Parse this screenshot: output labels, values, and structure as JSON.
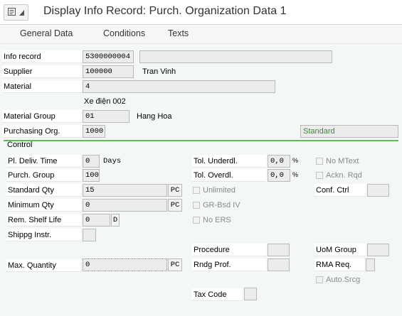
{
  "window": {
    "title": "Display Info Record: Purch. Organization Data 1"
  },
  "tabs": [
    {
      "label": "General Data"
    },
    {
      "label": "Conditions"
    },
    {
      "label": "Texts"
    }
  ],
  "header": {
    "info_record_label": "Info record",
    "info_record_value": "5300000004",
    "supplier_label": "Supplier",
    "supplier_value": "100000",
    "supplier_name": "Tran Vinh",
    "material_label": "Material",
    "material_value": "4",
    "material_desc": "Xe điện 002",
    "material_group_label": "Material Group",
    "material_group_value": "01",
    "material_group_desc": "Hang Hoa",
    "purch_org_label": "Purchasing Org.",
    "purch_org_value": "1000",
    "standard_label": "Standard"
  },
  "control": {
    "title": "Control",
    "pl_deliv_time_label": "Pl. Deliv. Time",
    "pl_deliv_time_value": "0",
    "days_label": "Days",
    "purch_group_label": "Purch. Group",
    "purch_group_value": "100",
    "standard_qty_label": "Standard Qty",
    "standard_qty_value": "15",
    "standard_qty_unit": "PC",
    "minimum_qty_label": "Minimum Qty",
    "minimum_qty_value": "0",
    "minimum_qty_unit": "PC",
    "rem_shelf_life_label": "Rem. Shelf Life",
    "rem_shelf_life_value": "0",
    "rem_shelf_life_unit": "D",
    "shippg_instr_label": "Shippg Instr.",
    "max_quantity_label": "Max. Quantity",
    "max_quantity_value": "0",
    "max_quantity_unit": "PC",
    "tol_underdl_label": "Tol. Underdl.",
    "tol_underdl_value": "0,0",
    "tol_overdl_label": "Tol. Overdl.",
    "tol_overdl_value": "0,0",
    "percent": "%",
    "unlimited_label": "Unlimited",
    "gr_bsd_iv_label": "GR-Bsd IV",
    "no_ers_label": "No ERS",
    "no_mtext_label": "No MText",
    "ackn_rqd_label": "Ackn. Rqd",
    "conf_ctrl_label": "Conf. Ctrl",
    "procedure_label": "Procedure",
    "uom_group_label": "UoM Group",
    "rndg_prof_label": "Rndg Prof.",
    "rma_req_label": "RMA Req.",
    "auto_srcg_label": "Auto.Srcg",
    "tax_code_label": "Tax Code"
  },
  "colors": {
    "accent": "#5bbf55",
    "readonly_bg": "#ececec"
  },
  "icons": {
    "menu": "menu-icon",
    "dropdown": "chevron-down-icon"
  }
}
